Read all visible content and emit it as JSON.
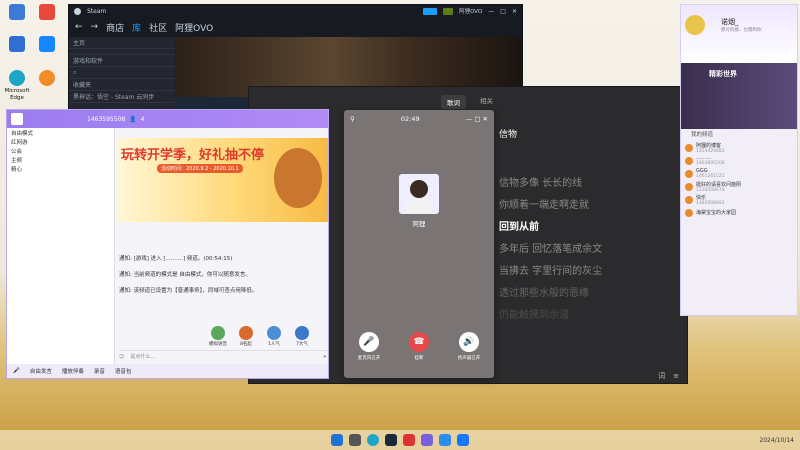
{
  "desktop": {
    "icons": [
      {
        "label": "",
        "name": "desktop-icon-1",
        "color": "#3b7bd6"
      },
      {
        "label": "",
        "name": "desktop-icon-2",
        "color": "#e8493c"
      },
      {
        "label": "",
        "name": "desktop-icon-3",
        "color": "#2f6fd3"
      },
      {
        "label": "",
        "name": "desktop-icon-4",
        "color": "#1688ff"
      },
      {
        "label": "Microsoft Edge",
        "name": "edge-icon",
        "color": "#1ea6c7"
      },
      {
        "label": "",
        "name": "desktop-icon-6",
        "color": "#f28c28"
      }
    ]
  },
  "steam": {
    "title": "Steam",
    "nav": [
      "商店",
      "库",
      "社区",
      "阿狸OVO"
    ],
    "active_nav": "库",
    "sidebar": [
      "主页",
      "游戏和软件",
      "收藏夹",
      "黑神话：悟空 - Steam 云同步"
    ]
  },
  "music": {
    "tabs": [
      "歌词",
      "相关"
    ],
    "active_tab": "歌词",
    "title": "信物",
    "lyrics": [
      "信物多像 长长的线",
      "你顺着一端走啊走就",
      "回到从前",
      "多年后 回忆落笔成余文",
      "当拂去 字里行间的灰尘",
      "透过那些水般的恩缘",
      "仍能触摸到余温"
    ],
    "current_line": 2,
    "bottom": [
      "词",
      "≡"
    ]
  },
  "qq": {
    "id": "1463595508",
    "members": "4",
    "left_rows": [
      "自由模式",
      "红网游",
      "公会",
      "主频",
      "精心"
    ],
    "banner_big": "玩转开学季，好礼抽不停",
    "banner_date": "活动时间：2020.9.2 - 2020.10.1",
    "messages": [
      "通知: [游戏] 进入 [..........] 频道。(00:54:15)",
      "通知: 当前频道的模式是 自由模式，你可以随意发言。",
      "通知: 该频道已设置为【普通事务】，同域可查点用降低。"
    ],
    "gifts": [
      "模拟语音",
      "8名起",
      "1人气",
      "7大气"
    ],
    "input_placeholder": "说点什么…",
    "footer": [
      "自由发言",
      "播放伴奏",
      "录音",
      "语音包"
    ]
  },
  "call": {
    "time": "02:49",
    "name": "阿狸",
    "buttons": [
      {
        "label": "麦克风已开",
        "name": "mic-button",
        "color": "#ffffff",
        "icon": "mic-icon"
      },
      {
        "label": "挂断",
        "name": "hangup-button",
        "color": "#e8484a",
        "icon": "phone-icon"
      },
      {
        "label": "扬声器已开",
        "name": "speaker-button",
        "color": "#ffffff",
        "icon": "speaker-icon"
      }
    ]
  },
  "rpanel": {
    "user": "诺烟_",
    "signature": "那片的那，也需和你",
    "banner": "精彩世界",
    "list_title": "我的频道",
    "items": [
      {
        "name": "阿狸的博客",
        "sub": "1354429883"
      },
      {
        "name": "………",
        "sub": "1463895508"
      },
      {
        "name": "GGG",
        "sub": "1461261525"
      },
      {
        "name": "挺好的请喜欢问施阴",
        "sub": "1234508678"
      },
      {
        "name": "快乐",
        "sub": "1482008692"
      },
      {
        "name": "海棠宝宝的大家园",
        "sub": ""
      }
    ]
  },
  "taskbar": {
    "clock": "2024/10/14"
  }
}
